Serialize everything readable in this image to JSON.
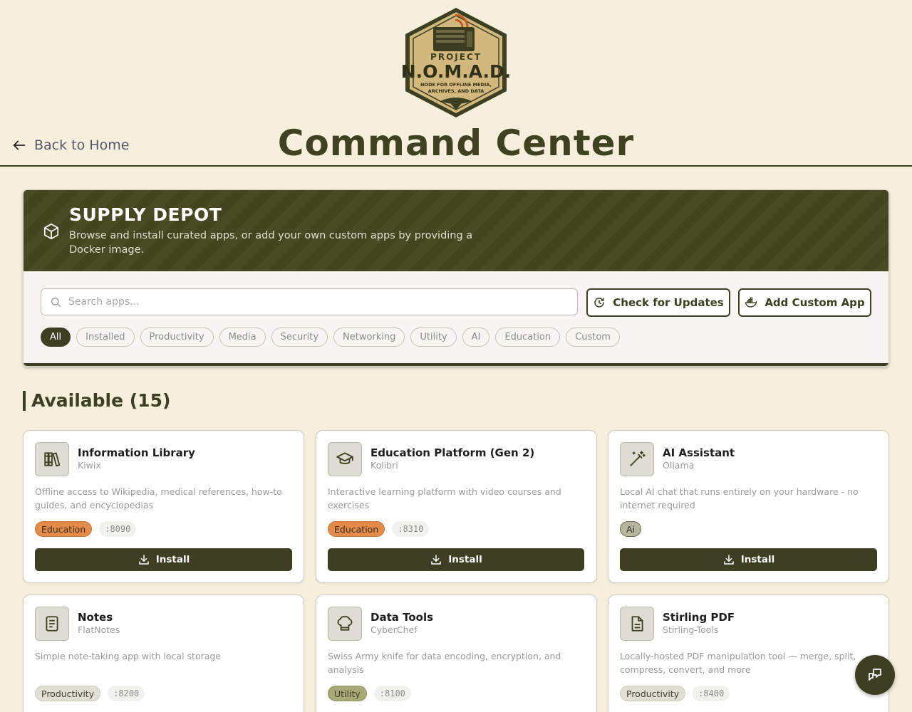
{
  "header": {
    "logo_project": "PROJECT",
    "logo_name": "N.O.M.A.D.",
    "logo_tagline_1": "NODE FOR OFFLINE MEDIA,",
    "logo_tagline_2": "ARCHIVES, AND DATA",
    "title": "Command Center",
    "back_label": "Back to Home"
  },
  "depot": {
    "title": "SUPPLY DEPOT",
    "description": "Browse and install curated apps, or add your own custom apps by providing a Docker image.",
    "search_placeholder": "Search apps...",
    "check_updates_label": "Check for Updates",
    "add_custom_label": "Add Custom App",
    "filters": [
      {
        "label": "All",
        "active": true
      },
      {
        "label": "Installed"
      },
      {
        "label": "Productivity"
      },
      {
        "label": "Media"
      },
      {
        "label": "Security"
      },
      {
        "label": "Networking"
      },
      {
        "label": "Utility"
      },
      {
        "label": "AI"
      },
      {
        "label": "Education"
      },
      {
        "label": "Custom"
      }
    ]
  },
  "section": {
    "title": "Available (15)"
  },
  "apps": [
    {
      "name": "Information Library",
      "provider": "Kiwix",
      "description": "Offline access to Wikipedia, medical references, how-to guides, and encyclopedias",
      "tag": "Education",
      "port": ":8090",
      "icon": "books-icon",
      "install_label": "Install"
    },
    {
      "name": "Education Platform (Gen 2)",
      "provider": "Kolibri",
      "description": "Interactive learning platform with video courses and exercises",
      "tag": "Education",
      "port": ":8310",
      "icon": "graduation-cap-icon",
      "install_label": "Install"
    },
    {
      "name": "AI Assistant",
      "provider": "Ollama",
      "description": "Local AI chat that runs entirely on your hardware - no internet required",
      "tag": "Ai",
      "port": "",
      "icon": "magic-wand-icon",
      "install_label": "Install"
    },
    {
      "name": "Notes",
      "provider": "FlatNotes",
      "description": "Simple note-taking app with local storage",
      "tag": "Productivity",
      "port": ":8200",
      "icon": "notepad-icon"
    },
    {
      "name": "Data Tools",
      "provider": "CyberChef",
      "description": "Swiss Army knife for data encoding, encryption, and analysis",
      "tag": "Utility",
      "port": ":8100",
      "icon": "chef-hat-icon"
    },
    {
      "name": "Stirling PDF",
      "provider": "Stirling-Tools",
      "description": "Locally-hosted PDF manipulation tool — merge, split, compress, convert, and more",
      "tag": "Productivity",
      "port": ":8400",
      "icon": "document-icon"
    }
  ],
  "colors": {
    "brand": "#3d3f22",
    "background": "#f7eedc",
    "education": "#e48b4a",
    "utility": "#a7aa77"
  }
}
